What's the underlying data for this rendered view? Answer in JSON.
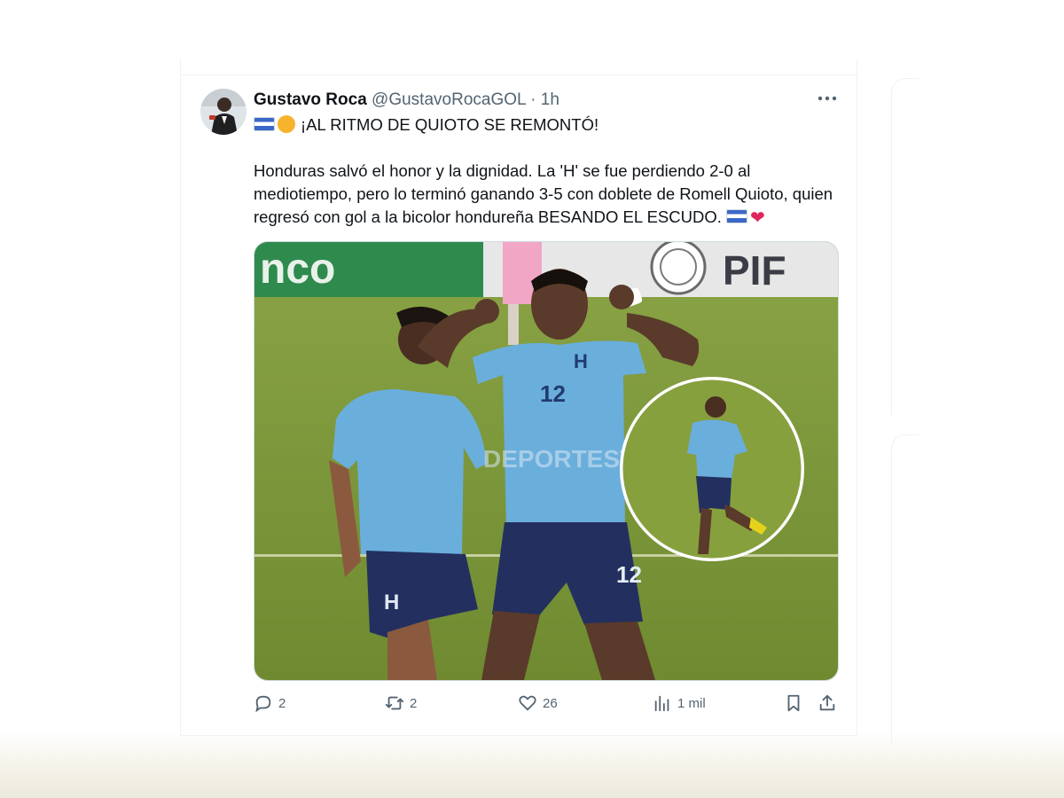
{
  "tweet": {
    "author_name": "Gustavo Roca",
    "handle": "@GustavoRocaGOL",
    "separator": "·",
    "time": "1h",
    "headline": "¡AL RITMO DE QUIOTO SE REMONTÓ!",
    "body": "Honduras salvó el honor y la dignidad. La 'H' se fue perdiendo 2-0 al mediotiempo, pero lo terminó ganando 3-5 con doblete de Romell Quioto, quien regresó con gol a la bicolor hondureña BESANDO EL ESCUDO.",
    "media": {
      "banner_left": "nco",
      "banner_right": "PIF",
      "watermark": "DEPORTESTV",
      "jersey_number": "12"
    },
    "actions": {
      "replies": "2",
      "retweets": "2",
      "likes": "26",
      "views": "1 mil"
    }
  },
  "icons": {
    "more": "more-dots-icon",
    "reply": "reply-icon",
    "retweet": "retweet-icon",
    "like": "heart-icon",
    "views": "views-chart-icon",
    "bookmark": "bookmark-icon",
    "share": "share-icon"
  },
  "colors": {
    "text": "#0f1419",
    "muted": "#536471",
    "border": "#eff3f4",
    "jersey": "#6aaedc",
    "shorts": "#23305f",
    "pitch": "#7f9a3a"
  }
}
